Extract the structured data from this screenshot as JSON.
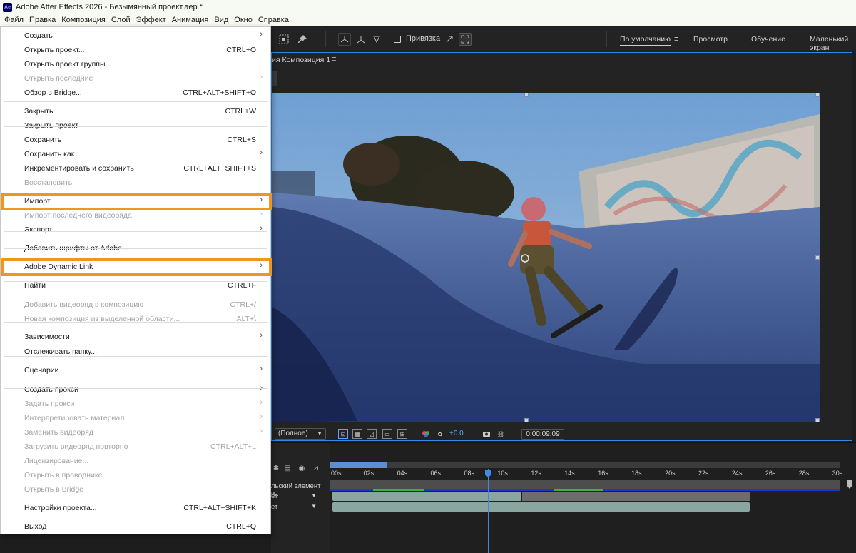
{
  "window": {
    "title": "Adobe After Effects 2026 - Безымянный проект.aep *",
    "app_icon": "Ae"
  },
  "menubar": [
    "Файл",
    "Правка",
    "Композиция",
    "Слой",
    "Эффект",
    "Анимация",
    "Вид",
    "Окно",
    "Справка"
  ],
  "toolbar": {
    "snap_label": "Привязка"
  },
  "workspaces": {
    "default": "По умолчанию",
    "menu_glyph": "≡",
    "items": [
      "Просмотр",
      "Обучение",
      "Маленький экран"
    ]
  },
  "composition": {
    "tab": "ия Композиция 1",
    "tab_menu": "≡",
    "resolution": "(Полное)",
    "exposure": "+0.0",
    "timecode": "0;00;09;09"
  },
  "timeline": {
    "ruler": [
      ":00s",
      "02s",
      "04s",
      "06s",
      "08s",
      "10s",
      "12s",
      "14s",
      "16s",
      "18s",
      "20s",
      "22s",
      "24s",
      "26s",
      "28s",
      "30s"
    ],
    "layers": [
      "льский элемент и..",
      "ет",
      "ет"
    ],
    "playhead_seconds": 9.3
  },
  "file_menu": {
    "items": [
      {
        "label": "Создать",
        "arrow": true
      },
      {
        "label": "Открыть проект...",
        "shortcut": "CTRL+O"
      },
      {
        "label": "Открыть проект группы..."
      },
      {
        "label": "Открыть последние",
        "arrow": true,
        "disabled": true
      },
      {
        "label": "Обзор в Bridge...",
        "shortcut": "CTRL+ALT+SHIFT+O"
      },
      {
        "label": "Закрыть",
        "shortcut": "CTRL+W"
      },
      {
        "label": "Закрыть проект"
      },
      {
        "label": "Сохранить",
        "shortcut": "CTRL+S"
      },
      {
        "label": "Сохранить как",
        "arrow": true
      },
      {
        "label": "Инкрементировать и сохранить",
        "shortcut": "CTRL+ALT+SHIFT+S"
      },
      {
        "label": "Восстановить",
        "disabled": true
      },
      {
        "label": "Импорт",
        "arrow": true,
        "highlight": true
      },
      {
        "label": "Импорт последнего видеоряда",
        "arrow": true,
        "disabled": true
      },
      {
        "label": "Экспорт",
        "arrow": true
      },
      {
        "label": "Добавить шрифты от Adobe..."
      },
      {
        "label": "Adobe Dynamic Link",
        "arrow": true,
        "highlight": true
      },
      {
        "label": "Найти",
        "shortcut": "CTRL+F"
      },
      {
        "label": "Добавить видеоряд в композицию",
        "shortcut": "CTRL+/",
        "disabled": true
      },
      {
        "label": "Новая композиция из выделенной области...",
        "shortcut": "ALT+\\",
        "disabled": true
      },
      {
        "label": "Зависимости",
        "arrow": true
      },
      {
        "label": "Отслеживать папку..."
      },
      {
        "label": "Сценарии",
        "arrow": true
      },
      {
        "label": "Создать прокси",
        "arrow": true
      },
      {
        "label": "Задать прокси",
        "arrow": true,
        "disabled": true
      },
      {
        "label": "Интерпретировать материал",
        "arrow": true,
        "disabled": true
      },
      {
        "label": "Заменить видеоряд",
        "arrow": true,
        "disabled": true
      },
      {
        "label": "Загрузить видеоряд повторно",
        "shortcut": "CTRL+ALT+L",
        "disabled": true
      },
      {
        "label": "Лицензирование...",
        "disabled": true
      },
      {
        "label": "Открыть в проводнике",
        "disabled": true
      },
      {
        "label": "Открыть в Bridge",
        "disabled": true
      },
      {
        "label": "Настройки проекта...",
        "shortcut": "CTRL+ALT+SHIFT+K"
      },
      {
        "label": "Выход",
        "shortcut": "CTRL+Q"
      }
    ]
  },
  "colors": {
    "highlight": "#f0961e",
    "accent": "#2d8ceb"
  }
}
